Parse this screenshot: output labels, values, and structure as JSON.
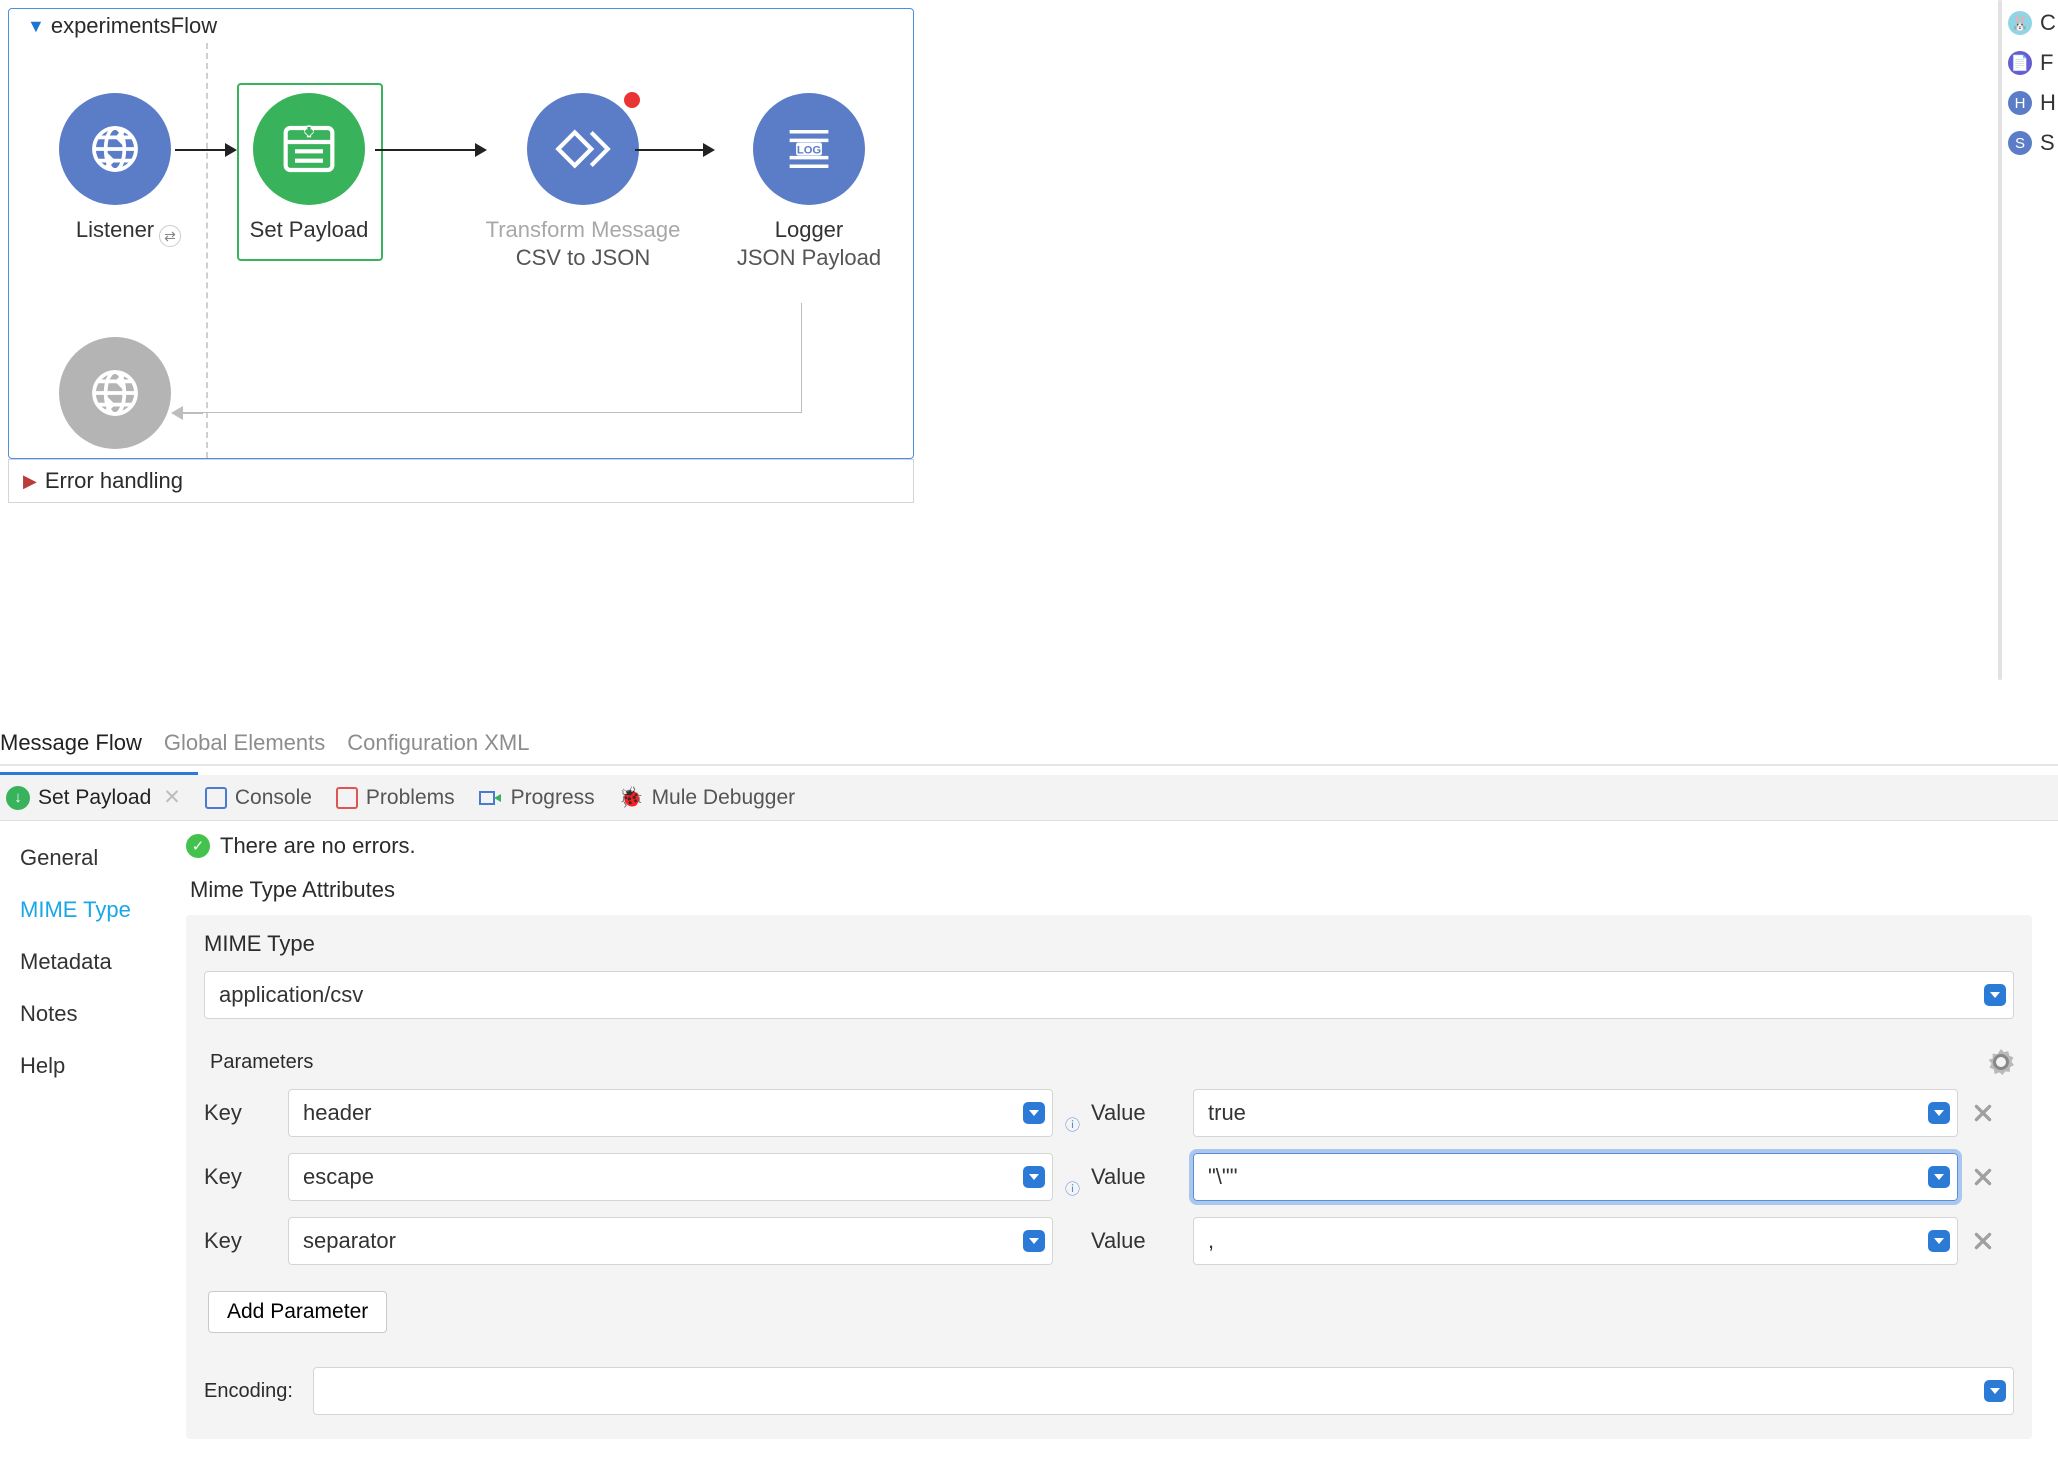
{
  "flow": {
    "name": "experimentsFlow",
    "error_section": "Error handling",
    "nodes": {
      "listener": {
        "label": "Listener"
      },
      "set_payload": {
        "label": "Set Payload"
      },
      "transform": {
        "label": "Transform Message",
        "sub": "CSV to JSON"
      },
      "logger": {
        "label": "Logger",
        "sub": "JSON Payload"
      }
    }
  },
  "subtabs": {
    "message_flow": "Message Flow",
    "global_elements": "Global Elements",
    "config_xml": "Configuration XML"
  },
  "panel_tabs": {
    "set_payload": "Set Payload",
    "console": "Console",
    "problems": "Problems",
    "progress": "Progress",
    "mule_debugger": "Mule Debugger"
  },
  "status": {
    "no_errors": "There are no errors."
  },
  "sidebar": {
    "general": "General",
    "mime_type": "MIME Type",
    "metadata": "Metadata",
    "notes": "Notes",
    "help": "Help"
  },
  "mime": {
    "attributes_title": "Mime Type Attributes",
    "label": "MIME Type",
    "value": "application/csv",
    "parameters_title": "Parameters",
    "key_label": "Key",
    "value_label": "Value",
    "rows": [
      {
        "key": "header",
        "value": "true"
      },
      {
        "key": "escape",
        "value": "\"\\\"\""
      },
      {
        "key": "separator",
        "value": ","
      }
    ],
    "add_parameter": "Add Parameter",
    "encoding_label": "Encoding:",
    "encoding_value": ""
  },
  "palette": {
    "items": [
      "C",
      "F",
      "H",
      "S"
    ]
  }
}
